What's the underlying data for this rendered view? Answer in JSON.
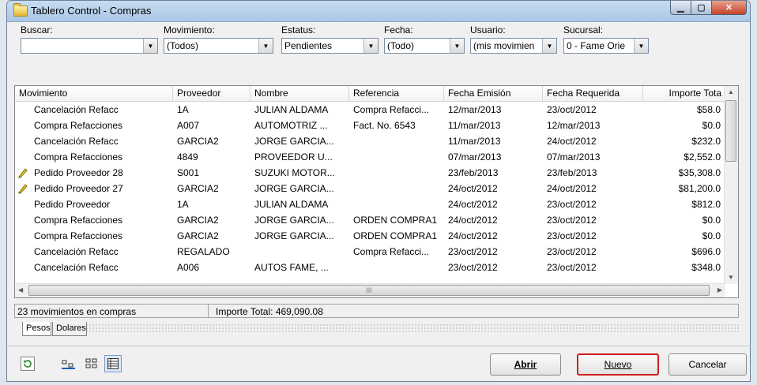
{
  "window": {
    "title": "Tablero Control - Compras"
  },
  "filters": [
    {
      "label": "Buscar:",
      "value": ""
    },
    {
      "label": "Movimiento:",
      "value": "(Todos)"
    },
    {
      "label": "Estatus:",
      "value": "Pendientes"
    },
    {
      "label": "Fecha:",
      "value": "(Todo)"
    },
    {
      "label": "Usuario:",
      "value": "(mis movimien"
    },
    {
      "label": "Sucursal:",
      "value": "0 - Fame Orie"
    }
  ],
  "grid": {
    "columns": [
      "Movimiento",
      "Proveedor",
      "Nombre",
      "Referencia",
      "Fecha Emisión",
      "Fecha Requerida",
      "Importe Tota"
    ],
    "rows": [
      {
        "flag": false,
        "cells": [
          "Cancelación Refacc",
          "1A",
          "JULIAN ALDAMA",
          "Compra Refacci...",
          "12/mar/2013",
          "23/oct/2012",
          "$58.0"
        ]
      },
      {
        "flag": false,
        "cells": [
          "Compra Refacciones",
          "A007",
          "AUTOMOTRIZ ...",
          "Fact. No. 6543",
          "11/mar/2013",
          "12/mar/2013",
          "$0.0"
        ]
      },
      {
        "flag": false,
        "cells": [
          "Cancelación Refacc",
          "GARCIA2",
          "JORGE GARCIA...",
          "",
          "11/mar/2013",
          "24/oct/2012",
          "$232.0"
        ]
      },
      {
        "flag": false,
        "cells": [
          "Compra Refacciones",
          "4849",
          "PROVEEDOR U...",
          "",
          "07/mar/2013",
          "07/mar/2013",
          "$2,552.0"
        ]
      },
      {
        "flag": true,
        "cells": [
          "Pedido Proveedor 28",
          "S001",
          "SUZUKI MOTOR...",
          "",
          "23/feb/2013",
          "23/feb/2013",
          "$35,308.0"
        ]
      },
      {
        "flag": true,
        "cells": [
          "Pedido Proveedor 27",
          "GARCIA2",
          "JORGE GARCIA...",
          "",
          "24/oct/2012",
          "24/oct/2012",
          "$81,200.0"
        ]
      },
      {
        "flag": false,
        "cells": [
          "Pedido Proveedor",
          "1A",
          "JULIAN ALDAMA",
          "",
          "24/oct/2012",
          "23/oct/2012",
          "$812.0"
        ]
      },
      {
        "flag": false,
        "cells": [
          "Compra Refacciones",
          "GARCIA2",
          "JORGE GARCIA...",
          "ORDEN COMPRA1",
          "24/oct/2012",
          "23/oct/2012",
          "$0.0"
        ]
      },
      {
        "flag": false,
        "cells": [
          "Compra Refacciones",
          "GARCIA2",
          "JORGE GARCIA...",
          "ORDEN COMPRA1",
          "24/oct/2012",
          "23/oct/2012",
          "$0.0"
        ]
      },
      {
        "flag": false,
        "cells": [
          "Cancelación Refacc",
          "REGALADO",
          "",
          "Compra Refacci...",
          "23/oct/2012",
          "23/oct/2012",
          "$696.0"
        ]
      },
      {
        "flag": false,
        "cells": [
          "Cancelación Refacc",
          "A006",
          "AUTOS FAME, ...",
          "",
          "23/oct/2012",
          "23/oct/2012",
          "$348.0"
        ]
      }
    ],
    "hscroll_grip": "III"
  },
  "status": {
    "count": "23 movimientos en compras",
    "total": "Importe Total: 469,090.08"
  },
  "tabs": [
    "Pesos",
    "Dolares"
  ],
  "buttons": {
    "open": "Abrir",
    "new": "Nuevo",
    "cancel": "Cancelar"
  },
  "icons": [
    "refresh-icon",
    "detail-view-icon",
    "list-view-icon",
    "grid-view-icon"
  ]
}
